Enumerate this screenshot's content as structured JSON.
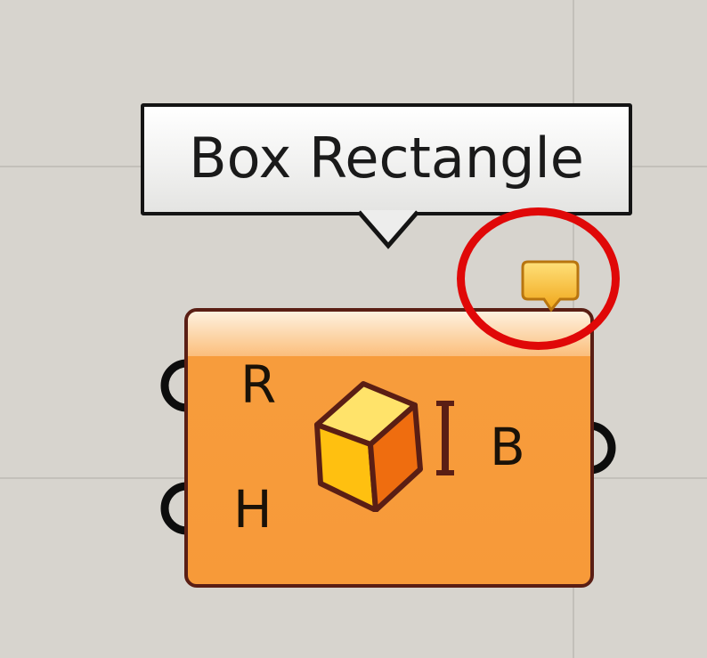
{
  "canvas": {
    "background_color": "#d7d4ce",
    "grid_color": "#c3c0ba"
  },
  "tooltip": {
    "text": "Box Rectangle"
  },
  "component": {
    "name": "Box Rectangle",
    "icon": "box-cube-icon",
    "fill_color": "#f79a39",
    "border_color": "#5a1e14",
    "inputs": [
      {
        "label": "R"
      },
      {
        "label": "H"
      }
    ],
    "outputs": [
      {
        "label": "B"
      }
    ]
  },
  "warning_balloon": {
    "icon": "message-balloon-icon",
    "color": "#f5b82a"
  },
  "annotation": {
    "shape": "circle",
    "color": "#e00808"
  }
}
